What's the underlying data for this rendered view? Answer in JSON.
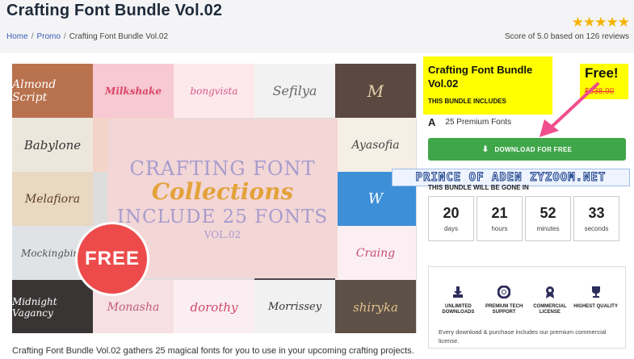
{
  "page": {
    "title": "Crafting Font Bundle Vol.02",
    "rating_stars": "★★★★★",
    "score_text": "Score of 5.0 based on 126 reviews",
    "breadcrumb": [
      "Home",
      "Promo",
      "Crafting Font Bundle Vol.02"
    ],
    "description": "Crafting Font Bundle Vol.02 gathers 25 magical fonts for you to use in your upcoming crafting projects."
  },
  "mosaic": {
    "tiles": [
      "Almond Script",
      "Milkshake",
      "bongvista",
      "Sefilya",
      "",
      "Babylone",
      "",
      "",
      "",
      "Ayasofia",
      "Melafiora",
      "",
      "",
      "",
      "",
      "Mockingbird",
      "",
      "",
      "",
      "Craing",
      "Midnight Vagancy",
      "Monasha",
      "dorothy",
      "Morrissey",
      "shiryka"
    ],
    "center_lines": [
      "CRAFTING FONT",
      "Collections",
      "INCLUDE 25 FONTS",
      "VOL.02"
    ],
    "badge": "FREE"
  },
  "sidebar": {
    "bundle_title": "Crafting Font Bundle Vol.02",
    "includes_label": "THIS BUNDLE INCLUDES",
    "free_label": "Free!",
    "old_price": "$338.00",
    "fonts_icon": "A",
    "fonts_count": "25 Premium Fonts",
    "download_button": "DOWNLOAD FOR FREE",
    "watermark": "PRINCE OF ADEN ZYZOOM.NET",
    "gone_label": "THIS BUNDLE WILL BE GONE IN",
    "countdown": [
      {
        "value": "20",
        "unit": "days"
      },
      {
        "value": "21",
        "unit": "hours"
      },
      {
        "value": "52",
        "unit": "minutes"
      },
      {
        "value": "33",
        "unit": "seconds"
      }
    ],
    "features": [
      {
        "icon": "download-icon",
        "label": "UNLIMITED DOWNLOADS"
      },
      {
        "icon": "lifebuoy-icon",
        "label": "PREMIUM TECH SUPPORT"
      },
      {
        "icon": "award-icon",
        "label": "COMMERCIAL LICENSE"
      },
      {
        "icon": "trophy-icon",
        "label": "HIGHEST QUALITY"
      }
    ],
    "features_note": "Every download & purchase includes our premium commercial license."
  },
  "colors": {
    "accent_green": "#3fa649",
    "highlight_yellow": "#ffff00",
    "badge_red": "#ed4b4b",
    "link_blue": "#3b5bb5",
    "arrow_pink": "#f04e8c",
    "star_gold": "#f5b301"
  }
}
